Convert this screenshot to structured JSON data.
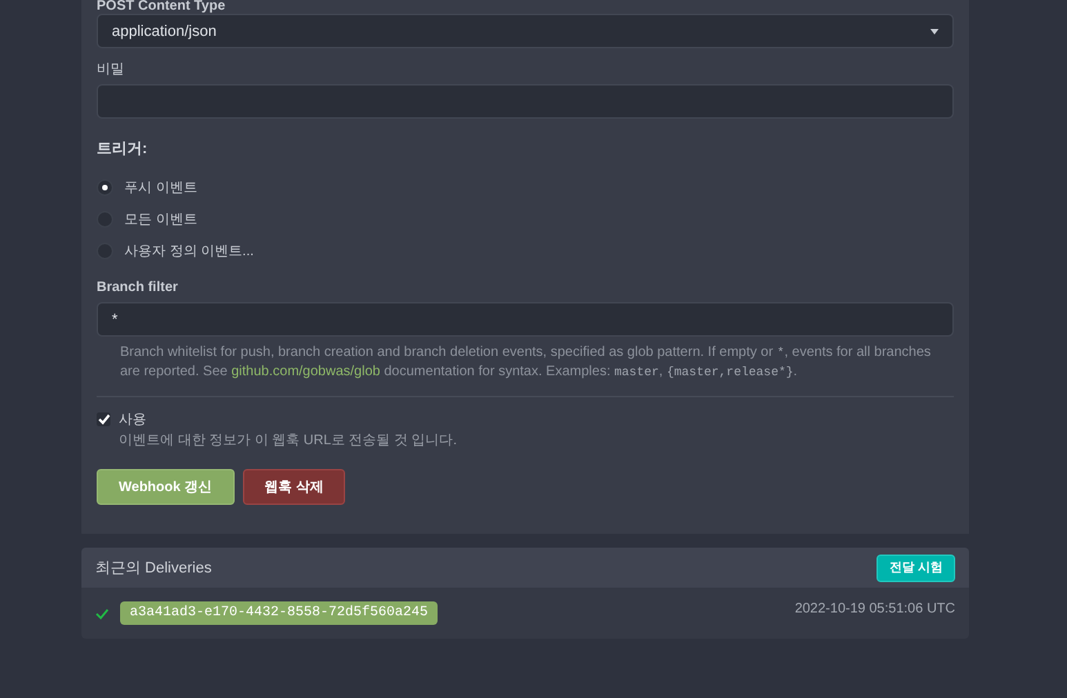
{
  "form": {
    "content_type": {
      "label": "POST Content Type",
      "value": "application/json"
    },
    "secret": {
      "label": "비밀"
    },
    "triggers": {
      "label": "트리거:",
      "options": [
        {
          "label": "푸시 이벤트",
          "selected": true
        },
        {
          "label": "모든 이벤트",
          "selected": false
        },
        {
          "label": "사용자 정의 이벤트...",
          "selected": false
        }
      ]
    },
    "branch_filter": {
      "label": "Branch filter",
      "value": "*",
      "help": [
        {
          "kind": "text",
          "text": "Branch whitelist for push, branch creation and branch deletion events, specified as glob pattern. If empty or "
        },
        {
          "kind": "code",
          "text": "*"
        },
        {
          "kind": "text",
          "text": ", events for all branches are reported. See "
        },
        {
          "kind": "link",
          "text": "github.com/gobwas/glob"
        },
        {
          "kind": "text",
          "text": " documentation for syntax. Examples: "
        },
        {
          "kind": "code",
          "text": "master"
        },
        {
          "kind": "text",
          "text": ", "
        },
        {
          "kind": "code",
          "text": "{master,release*}"
        },
        {
          "kind": "text",
          "text": "."
        }
      ]
    },
    "active": {
      "label": "사용",
      "checked": true,
      "description": "이벤트에 대한 정보가 이 웹훅 URL로 전송될 것 입니다."
    },
    "buttons": [
      {
        "kind": "primary",
        "label": "Webhook 갱신"
      },
      {
        "kind": "danger",
        "label": "웹훅 삭제"
      }
    ]
  },
  "deliveries": {
    "title": "최근의 Deliveries",
    "test_button": "전달 시험",
    "items": [
      {
        "success": true,
        "id": "a3a41ad3-e170-4432-8558-72d5f560a245",
        "time": "2022-10-19 05:51:06 UTC"
      }
    ]
  }
}
